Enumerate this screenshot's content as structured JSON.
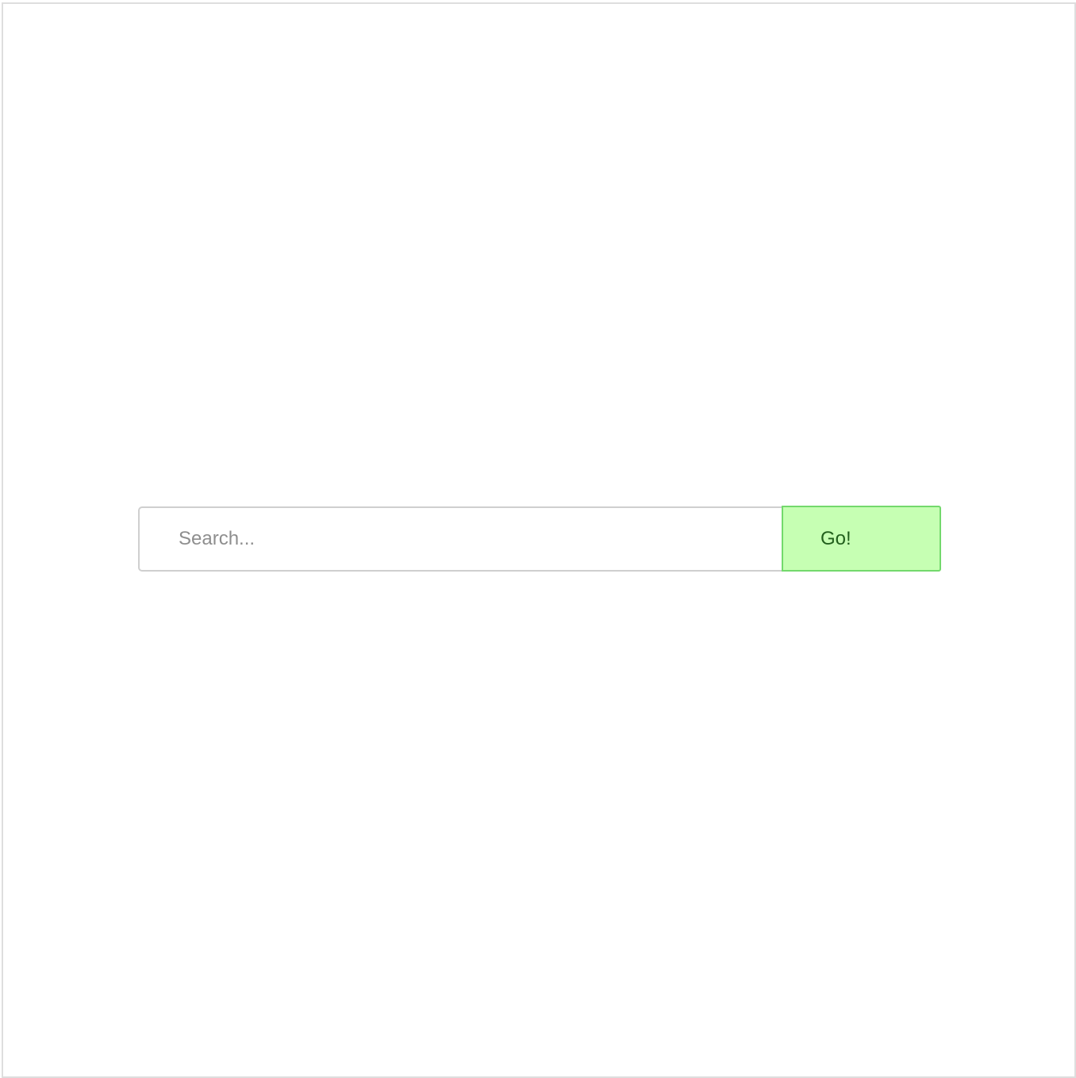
{
  "search": {
    "placeholder": "Search...",
    "value": "",
    "button_label": "Go!"
  },
  "colors": {
    "button_background": "#c6ffb3",
    "button_border": "#73d96c",
    "button_text": "#215f1c",
    "input_border": "#cfcfcf",
    "placeholder_text": "#8e8e8e",
    "frame_border": "#dedede"
  }
}
